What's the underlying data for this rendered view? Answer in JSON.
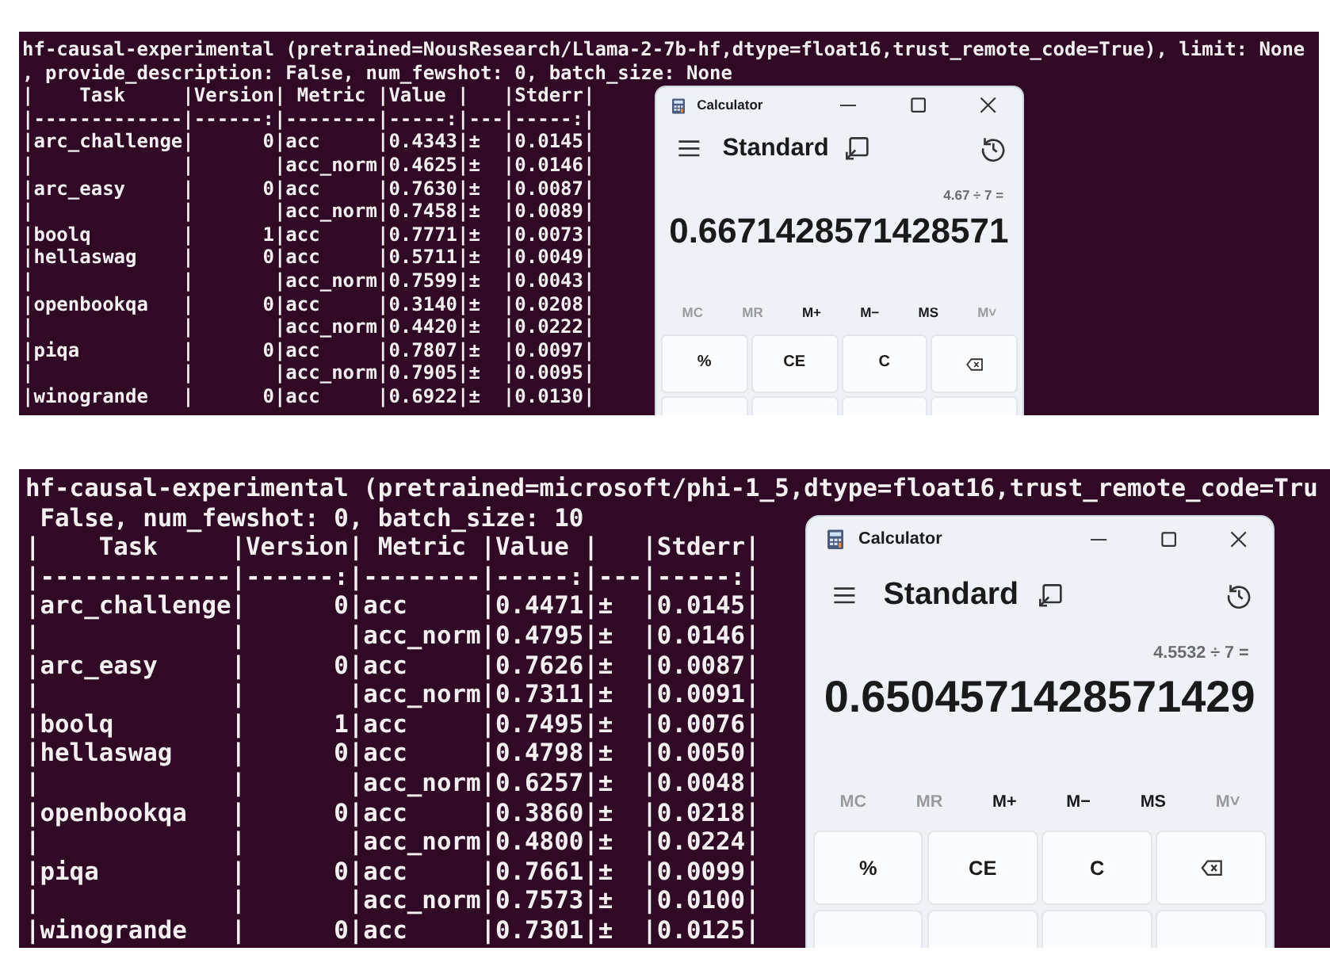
{
  "panels": [
    {
      "lines": [
        "hf-causal-experimental (pretrained=NousResearch/Llama-2-7b-hf,dtype=float16,trust_remote_code=True), limit: None",
        ", provide_description: False, num_fewshot: 0, batch_size: None",
        "|    Task     |Version| Metric |Value |   |Stderr|",
        "|-------------|------:|--------|-----:|---|-----:|",
        "|arc_challenge|      0|acc     |0.4343|±  |0.0145|",
        "|             |       |acc_norm|0.4625|±  |0.0146|",
        "|arc_easy     |      0|acc     |0.7630|±  |0.0087|",
        "|             |       |acc_norm|0.7458|±  |0.0089|",
        "|boolq        |      1|acc     |0.7771|±  |0.0073|",
        "|hellaswag    |      0|acc     |0.5711|±  |0.0049|",
        "|             |       |acc_norm|0.7599|±  |0.0043|",
        "|openbookqa   |      0|acc     |0.3140|±  |0.0208|",
        "|             |       |acc_norm|0.4420|±  |0.0222|",
        "|piqa         |      0|acc     |0.7807|±  |0.0097|",
        "|             |       |acc_norm|0.7905|±  |0.0095|",
        "|winogrande   |      0|acc     |0.6922|±  |0.0130|"
      ],
      "calculator": {
        "title": "Calculator",
        "mode": "Standard",
        "expression": "4.67 ÷ 7 =",
        "result": "0.6671428571428571",
        "memory": [
          {
            "label": "MC",
            "disabled": true
          },
          {
            "label": "MR",
            "disabled": true
          },
          {
            "label": "M+",
            "disabled": false
          },
          {
            "label": "M−",
            "disabled": false
          },
          {
            "label": "MS",
            "disabled": false
          },
          {
            "label": "M˅",
            "disabled": true
          }
        ],
        "keys": [
          {
            "kind": "text",
            "label": "%"
          },
          {
            "kind": "text",
            "label": "CE"
          },
          {
            "kind": "text",
            "label": "C"
          },
          {
            "kind": "backspace"
          }
        ]
      }
    },
    {
      "lines": [
        "hf-causal-experimental (pretrained=microsoft/phi-1_5,dtype=float16,trust_remote_code=Tru",
        " False, num_fewshot: 0, batch_size: 10",
        "|    Task     |Version| Metric |Value |   |Stderr|",
        "|-------------|------:|--------|-----:|---|-----:|",
        "|arc_challenge|      0|acc     |0.4471|±  |0.0145|",
        "|             |       |acc_norm|0.4795|±  |0.0146|",
        "|arc_easy     |      0|acc     |0.7626|±  |0.0087|",
        "|             |       |acc_norm|0.7311|±  |0.0091|",
        "|boolq        |      1|acc     |0.7495|±  |0.0076|",
        "|hellaswag    |      0|acc     |0.4798|±  |0.0050|",
        "|             |       |acc_norm|0.6257|±  |0.0048|",
        "|openbookqa   |      0|acc     |0.3860|±  |0.0218|",
        "|             |       |acc_norm|0.4800|±  |0.0224|",
        "|piqa         |      0|acc     |0.7661|±  |0.0099|",
        "|             |       |acc_norm|0.7573|±  |0.0100|",
        "|winogrande   |      0|acc     |0.7301|±  |0.0125|"
      ],
      "calculator": {
        "title": "Calculator",
        "mode": "Standard",
        "expression": "4.5532 ÷ 7 =",
        "result": "0.6504571428571429",
        "memory": [
          {
            "label": "MC",
            "disabled": true
          },
          {
            "label": "MR",
            "disabled": true
          },
          {
            "label": "M+",
            "disabled": false
          },
          {
            "label": "M−",
            "disabled": false
          },
          {
            "label": "MS",
            "disabled": false
          },
          {
            "label": "M˅",
            "disabled": true
          }
        ],
        "keys": [
          {
            "kind": "text",
            "label": "%"
          },
          {
            "kind": "text",
            "label": "CE"
          },
          {
            "kind": "text",
            "label": "C"
          },
          {
            "kind": "backspace"
          }
        ]
      }
    }
  ]
}
